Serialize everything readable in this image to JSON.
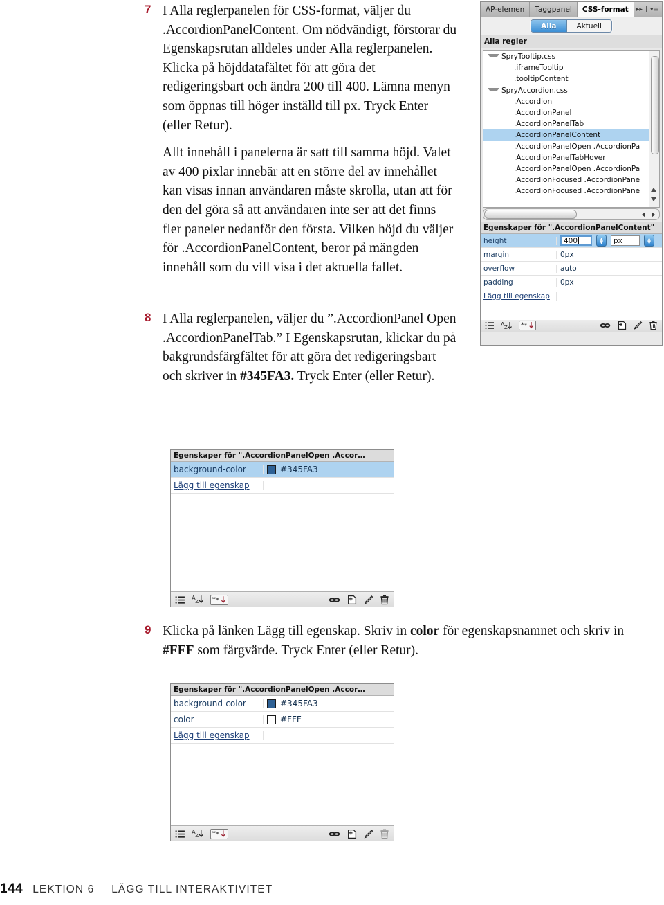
{
  "steps": [
    {
      "number": "7",
      "paragraphs": [
        "I Alla reglerpanelen för CSS-format, väljer du .AccordionPanelContent. Om nödvändigt, förstorar du Egenskapsrutan alldeles under Alla reglerpanelen. Klicka på höjddatafältet för att göra det redigeringsbart och ändra 200 till 400. Lämna menyn som öppnas till höger inställd till px. Tryck Enter (eller Retur).",
        "Allt innehåll i panelerna är satt till samma höjd. Valet av 400 pixlar innebär att en större del av innehållet kan visas innan användaren måste skrolla, utan att för den del göra så att användaren inte ser att det finns fler paneler nedanför den första. Vilken höjd du väljer för .AccordionPanelContent, beror på mängden innehåll som du vill visa i det aktuella fallet."
      ]
    },
    {
      "number": "8",
      "paragraph_parts": [
        "I Alla reglerpanelen, väljer du ”.AccordionPanel Open .AccordionPanelTab.” I Egenskapsrutan, klickar du på bakgrundsfärgfältet för att göra det redigeringsbart och skriver in ",
        "#345FA3.",
        " Tryck Enter (eller Retur)."
      ]
    },
    {
      "number": "9",
      "paragraph_parts": [
        "Klicka på länken Lägg till egenskap. Skriv in ",
        "color",
        " för egenskapsnamnet och skriv in ",
        "#FFF",
        " som färgvärde. Tryck Enter (eller Retur)."
      ]
    }
  ],
  "footer": {
    "page_number": "144",
    "lesson": "LEKTION 6",
    "chapter": "LÄGG TILL INTERAKTIVITET"
  },
  "css_panel": {
    "tabs": [
      {
        "label": "AP-elemen",
        "active": false
      },
      {
        "label": "Taggpanel",
        "active": false
      },
      {
        "label": "CSS-format",
        "active": true
      }
    ],
    "tab_controls": {
      "expand": "▸▸",
      "divider": "|",
      "menu": "▾≡"
    },
    "segmented": [
      {
        "label": "Alla",
        "selected": true
      },
      {
        "label": "Aktuell",
        "selected": false
      }
    ],
    "section_title": "Alla regler",
    "rules": [
      {
        "label": "SpryTooltip.css",
        "indent": 0,
        "twisty": true,
        "selected": false
      },
      {
        "label": ".iframeTooltip",
        "indent": 2,
        "twisty": false,
        "selected": false
      },
      {
        "label": ".tooltipContent",
        "indent": 2,
        "twisty": false,
        "selected": false
      },
      {
        "label": "SpryAccordion.css",
        "indent": 0,
        "twisty": true,
        "selected": false
      },
      {
        "label": ".Accordion",
        "indent": 2,
        "twisty": false,
        "selected": false
      },
      {
        "label": ".AccordionPanel",
        "indent": 2,
        "twisty": false,
        "selected": false
      },
      {
        "label": ".AccordionPanelTab",
        "indent": 2,
        "twisty": false,
        "selected": false
      },
      {
        "label": ".AccordionPanelContent",
        "indent": 2,
        "twisty": false,
        "selected": true
      },
      {
        "label": ".AccordionPanelOpen .AccordionPa",
        "indent": 2,
        "twisty": false,
        "selected": false
      },
      {
        "label": ".AccordionPanelTabHover",
        "indent": 2,
        "twisty": false,
        "selected": false
      },
      {
        "label": ".AccordionPanelOpen .AccordionPa",
        "indent": 2,
        "twisty": false,
        "selected": false
      },
      {
        "label": ".AccordionFocused .AccordionPane",
        "indent": 2,
        "twisty": false,
        "selected": false
      },
      {
        "label": ".AccordionFocused .AccordionPane",
        "indent": 2,
        "twisty": false,
        "selected": false
      }
    ],
    "properties_title": "Egenskaper för \".AccordionPanelContent\"",
    "properties": [
      {
        "name": "height",
        "value": "400",
        "unit": "px",
        "editing": true,
        "highlight": true
      },
      {
        "name": "margin",
        "value": "0px",
        "editing": false,
        "highlight": false
      },
      {
        "name": "overflow",
        "value": "auto",
        "editing": false,
        "highlight": false
      },
      {
        "name": "padding",
        "value": "0px",
        "editing": false,
        "highlight": false
      }
    ],
    "add_property_link": "Lägg till egenskap",
    "toolbar": {
      "left": [
        "category-view-icon",
        "alphabet-sort-icon",
        "set-properties-icon"
      ],
      "right": [
        "attach-stylesheet-icon",
        "new-css-rule-icon",
        "edit-rule-icon",
        "delete-rule-icon"
      ]
    }
  },
  "bg_panel_1": {
    "properties_title": "Egenskaper för \".AccordionPanelOpen .Accor…",
    "properties": [
      {
        "name": "background-color",
        "value": "#345FA3",
        "swatch": "#2e6195",
        "highlight": true
      }
    ],
    "add_property_link": "Lägg till egenskap"
  },
  "bg_panel_2": {
    "properties_title": "Egenskaper för \".AccordionPanelOpen .Accor…",
    "properties": [
      {
        "name": "background-color",
        "value": "#345FA3",
        "swatch": "#2e6195",
        "highlight": false
      },
      {
        "name": "color",
        "value": "#FFF",
        "swatch": "#ffffff",
        "highlight": false
      }
    ],
    "add_property_link": "Lägg till egenskap"
  },
  "colors": {
    "step_number": "#a81c2e",
    "selection_blue": "#aed3f0",
    "accent_blue": "#3c8fd6",
    "background_color_value": "#345FA3",
    "color_value": "#FFF"
  }
}
